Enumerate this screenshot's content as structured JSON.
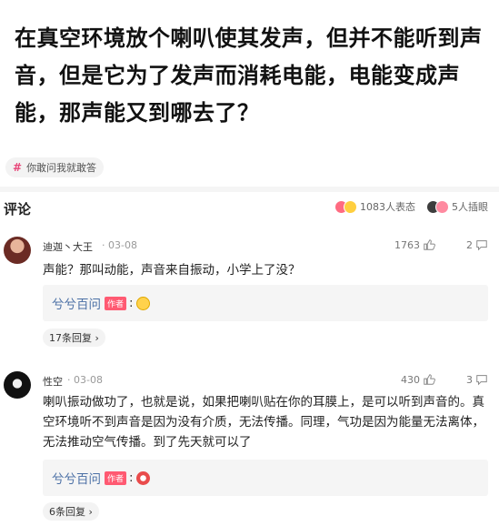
{
  "question": {
    "title": "在真空环境放个喇叭使其发声，但并不能听到声音，但是它为了发声而消耗电能，电能变成声能，那声能又到哪去了？"
  },
  "topic_tag": {
    "icon": "hash-icon",
    "label": "你敢问我就敢答"
  },
  "comments_header": {
    "title": "评论",
    "reaction_count": "1083人表态",
    "peek_count": "5人插眼"
  },
  "comments": [
    {
      "username": "迪迦丶大王",
      "date": "· 03-08",
      "likes": "1763",
      "replies": "2",
      "text": "声能？那叫动能，声音来自振动，小学上了没？",
      "sub_reply": {
        "author": "兮兮百问",
        "badge": "作者",
        "colon": ":"
      },
      "reply_label": "17条回复 ›"
    },
    {
      "username": "性空",
      "date": "· 03-08",
      "likes": "430",
      "replies": "3",
      "text": "喇叭振动做功了，也就是说，如果把喇叭贴在你的耳膜上，是可以听到声音的。真空环境听不到声音是因为没有介质，无法传播。同理，气功是因为能量无法离体，无法推动空气传播。到了先天就可以了",
      "sub_reply": {
        "author": "兮兮百问",
        "badge": "作者",
        "colon": ":"
      },
      "reply_label": "6条回复 ›"
    }
  ],
  "colors": {
    "accent_pink": "#ff5a72",
    "link_blue": "#4a6fa5",
    "hash_pink": "#e8477a"
  }
}
